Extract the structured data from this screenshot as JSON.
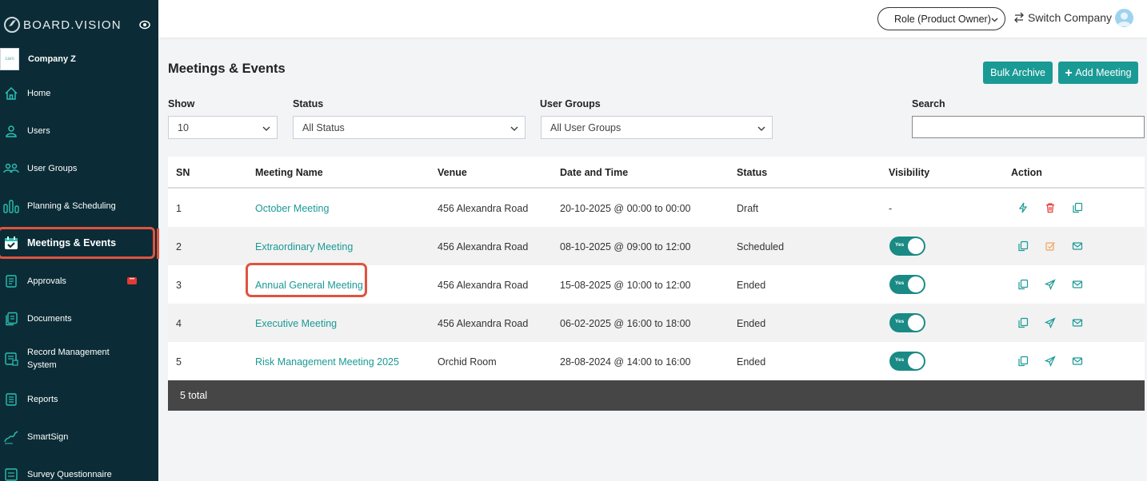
{
  "brand": {
    "name": "BOARD.VISION"
  },
  "company": {
    "name": "Company Z",
    "logo_text": "cars"
  },
  "sidebar": {
    "items": [
      {
        "label": "Home",
        "icon": "home-icon"
      },
      {
        "label": "Users",
        "icon": "user-icon"
      },
      {
        "label": "User Groups",
        "icon": "user-groups-icon"
      },
      {
        "label": "Planning & Scheduling",
        "icon": "bar-chart-icon"
      },
      {
        "label": "Meetings & Events",
        "icon": "calendar-icon",
        "active": true
      },
      {
        "label": "Approvals",
        "icon": "approval-icon",
        "badge": "•••"
      },
      {
        "label": "Documents",
        "icon": "documents-icon"
      },
      {
        "label": "Record Management",
        "label2": "System",
        "icon": "record-icon"
      },
      {
        "label": "Reports",
        "icon": "reports-icon"
      },
      {
        "label": "SmartSign",
        "icon": "signature-icon"
      },
      {
        "label": "Survey Questionnaire",
        "icon": "survey-icon"
      }
    ]
  },
  "topbar": {
    "role": "Role (Product Owner)",
    "switch_company": "Switch Company"
  },
  "page": {
    "title": "Meetings & Events",
    "bulk_archive": "Bulk Archive",
    "add_meeting": "Add Meeting"
  },
  "filters": {
    "show_label": "Show",
    "show_value": "10",
    "status_label": "Status",
    "status_value": "All Status",
    "groups_label": "User Groups",
    "groups_value": "All User Groups",
    "search_label": "Search",
    "search_value": ""
  },
  "table": {
    "headers": [
      "SN",
      "Meeting Name",
      "Venue",
      "Date and Time",
      "Status",
      "Visibility",
      "Action"
    ],
    "rows": [
      {
        "sn": "1",
        "name": "October Meeting",
        "venue": "456 Alexandra Road",
        "datetime": "20-10-2025 @ 00:00 to 00:00",
        "status": "Draft",
        "visibility": "-"
      },
      {
        "sn": "2",
        "name": "Extraordinary Meeting",
        "venue": "456 Alexandra Road",
        "datetime": "08-10-2025 @ 09:00 to 12:00",
        "status": "Scheduled",
        "visibility": "Yes"
      },
      {
        "sn": "3",
        "name": "Annual General Meeting",
        "venue": "456 Alexandra Road",
        "datetime": "15-08-2025 @ 10:00 to 12:00",
        "status": "Ended",
        "visibility": "Yes"
      },
      {
        "sn": "4",
        "name": "Executive Meeting",
        "venue": "456 Alexandra Road",
        "datetime": "06-02-2025 @ 16:00 to 18:00",
        "status": "Ended",
        "visibility": "Yes"
      },
      {
        "sn": "5",
        "name": "Risk Management Meeting 2025",
        "venue": "Orchid Room",
        "datetime": "28-08-2024 @ 14:00 to 16:00",
        "status": "Ended",
        "visibility": "Yes"
      }
    ],
    "footer": "5 total"
  },
  "colors": {
    "sidebar": "#0b2c36",
    "accent": "#1a9a95",
    "highlight": "#e0533d",
    "danger": "#e53935",
    "warning": "#f0a35c"
  }
}
